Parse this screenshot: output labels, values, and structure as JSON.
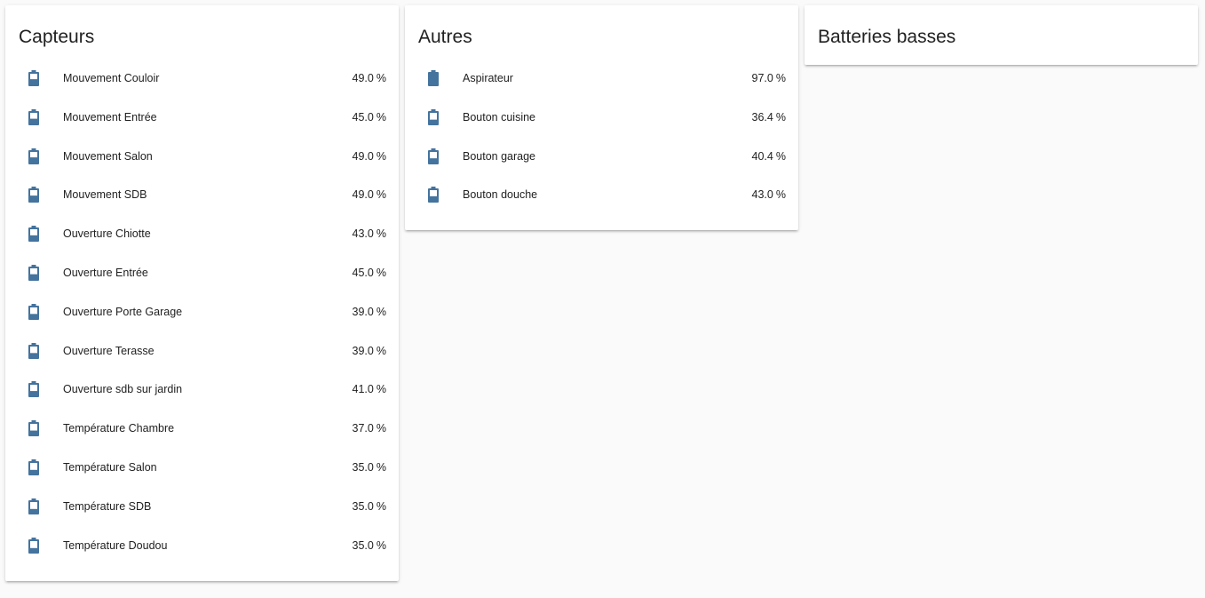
{
  "colors": {
    "icon": "#44739e",
    "background": "#fafafa",
    "card": "#ffffff",
    "text": "#212121"
  },
  "cards": [
    {
      "title": "Capteurs",
      "entities": [
        {
          "name": "Mouvement Couloir",
          "value": "49.0",
          "unit": "%",
          "level": 0.49,
          "icon": "battery-icon"
        },
        {
          "name": "Mouvement Entrée",
          "value": "45.0",
          "unit": "%",
          "level": 0.45,
          "icon": "battery-icon"
        },
        {
          "name": "Mouvement Salon",
          "value": "49.0",
          "unit": "%",
          "level": 0.49,
          "icon": "battery-icon"
        },
        {
          "name": "Mouvement SDB",
          "value": "49.0",
          "unit": "%",
          "level": 0.49,
          "icon": "battery-icon"
        },
        {
          "name": "Ouverture Chiotte",
          "value": "43.0",
          "unit": "%",
          "level": 0.43,
          "icon": "battery-icon"
        },
        {
          "name": "Ouverture Entrée",
          "value": "45.0",
          "unit": "%",
          "level": 0.45,
          "icon": "battery-icon"
        },
        {
          "name": "Ouverture Porte Garage",
          "value": "39.0",
          "unit": "%",
          "level": 0.39,
          "icon": "battery-icon"
        },
        {
          "name": "Ouverture Terasse",
          "value": "39.0",
          "unit": "%",
          "level": 0.39,
          "icon": "battery-icon"
        },
        {
          "name": "Ouverture sdb sur jardin",
          "value": "41.0",
          "unit": "%",
          "level": 0.41,
          "icon": "battery-icon"
        },
        {
          "name": "Température Chambre",
          "value": "37.0",
          "unit": "%",
          "level": 0.37,
          "icon": "battery-icon"
        },
        {
          "name": "Température Salon",
          "value": "35.0",
          "unit": "%",
          "level": 0.35,
          "icon": "battery-icon"
        },
        {
          "name": "Température SDB",
          "value": "35.0",
          "unit": "%",
          "level": 0.35,
          "icon": "battery-icon"
        },
        {
          "name": "Température Doudou",
          "value": "35.0",
          "unit": "%",
          "level": 0.35,
          "icon": "battery-icon"
        }
      ]
    },
    {
      "title": "Autres",
      "entities": [
        {
          "name": "Aspirateur",
          "value": "97.0",
          "unit": "%",
          "level": 0.97,
          "icon": "battery-icon"
        },
        {
          "name": "Bouton cuisine",
          "value": "36.4",
          "unit": "%",
          "level": 0.364,
          "icon": "battery-icon"
        },
        {
          "name": "Bouton garage",
          "value": "40.4",
          "unit": "%",
          "level": 0.404,
          "icon": "battery-icon"
        },
        {
          "name": "Bouton douche",
          "value": "43.0",
          "unit": "%",
          "level": 0.43,
          "icon": "battery-icon"
        }
      ]
    },
    {
      "title": "Batteries basses",
      "entities": []
    }
  ]
}
